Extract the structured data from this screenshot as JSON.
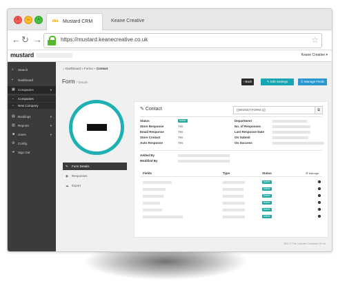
{
  "browser": {
    "tabs": [
      {
        "label": "Mustard CRM",
        "favicon": "ms",
        "active": true
      },
      {
        "label": "Keane Creative",
        "active": false
      }
    ],
    "url": "https://mustard.keanecreative.co.uk"
  },
  "app": {
    "logo": "mustard",
    "user": "Keane Creative"
  },
  "sidebar": {
    "search": "Search",
    "items": [
      {
        "label": "Dashboard",
        "icon": "gauge-icon"
      },
      {
        "label": "Companies",
        "icon": "building-icon"
      },
      {
        "label": "Bookings",
        "icon": "calendar-icon"
      },
      {
        "label": "Reports",
        "icon": "chart-icon"
      },
      {
        "label": "Users",
        "icon": "users-icon"
      },
      {
        "label": "Config",
        "icon": "gear-icon"
      },
      {
        "label": "Sign Out",
        "icon": "sign-out-icon"
      }
    ],
    "sub": [
      "Companies",
      "New Company"
    ]
  },
  "breadcrumb": {
    "items": [
      "Dashboard",
      "Forms",
      "Contact"
    ]
  },
  "page": {
    "title": "Form",
    "subtitle": "/ Details",
    "back": "Back",
    "edit": "Edit Settings",
    "manage": "Manage Fields"
  },
  "formmenu": [
    "Form Details",
    "Responses",
    "Export"
  ],
  "panel": {
    "title": "Contact",
    "widget": "{{WIDGET:FORM:1}}",
    "left": [
      {
        "label": "Status",
        "value": "Active"
      },
      {
        "label": "Store Response",
        "value": "Yes"
      },
      {
        "label": "Email Response",
        "value": "Yes"
      },
      {
        "label": "Store Contact",
        "value": "Yes"
      },
      {
        "label": "Auto Response",
        "value": "Yes"
      }
    ],
    "right": [
      "Department",
      "No. of Responses",
      "Last Response Date",
      "On Submit",
      "On Success"
    ],
    "added": "Added By",
    "modified": "Modified By",
    "table": {
      "headers": [
        "Fields",
        "Type",
        "Status",
        "Manage"
      ],
      "status": "Active",
      "rows": 6
    }
  },
  "footer": "2021 © The Lockside Company UK Ltd.",
  "colors": {
    "accent": "#1fb0b4",
    "sidebar": "#3b3b3b",
    "edit": "#16a6b3",
    "manage": "#2996cf"
  }
}
